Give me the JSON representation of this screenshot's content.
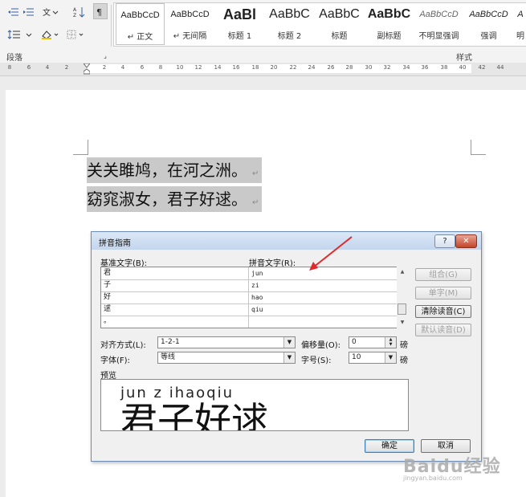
{
  "ribbon": {
    "paragraph_group_label": "段落",
    "styles_group_label": "样式",
    "styles": [
      {
        "preview": "AaBbCcD",
        "name": "↵ 正文",
        "selected": true
      },
      {
        "preview": "AaBbCcD",
        "name": "↵ 无间隔",
        "selected": false
      },
      {
        "preview": "AaBl",
        "name": "标题 1",
        "selected": false
      },
      {
        "preview": "AaBbC",
        "name": "标题 2",
        "selected": false
      },
      {
        "preview": "AaBbC",
        "name": "标题",
        "selected": false
      },
      {
        "preview": "AaBbC",
        "name": "副标题",
        "selected": false
      },
      {
        "preview": "AaBbCcD",
        "name": "不明显强调",
        "selected": false
      },
      {
        "preview": "AaBbCcD",
        "name": "强调",
        "selected": false
      },
      {
        "preview": "A",
        "name": "明",
        "selected": false
      }
    ],
    "icons": [
      "decrease-indent-icon",
      "increase-indent-icon",
      "asian-layout-icon",
      "sort-icon",
      "show-marks-icon",
      "line-spacing-icon",
      "shading-icon",
      "borders-icon"
    ]
  },
  "ruler": {
    "ticks": [
      "8",
      "6",
      "4",
      "2",
      "",
      "2",
      "4",
      "6",
      "8",
      "10",
      "12",
      "14",
      "16",
      "18",
      "20",
      "22",
      "24",
      "26",
      "28",
      "30",
      "32",
      "34",
      "36",
      "38",
      "40",
      "42",
      "44"
    ]
  },
  "document": {
    "lines": [
      "关关雎鸠，在河之洲。",
      "窈窕淑女，君子好逑。"
    ],
    "paragraph_mark": "↵"
  },
  "dialog": {
    "title": "拼音指南",
    "help_label": "?",
    "close_label": "✕",
    "base_text_label": "基准文字(B):",
    "ruby_text_label": "拼音文字(R):",
    "rows": [
      {
        "base": "君",
        "ruby": "jun"
      },
      {
        "base": "子",
        "ruby": "zi"
      },
      {
        "base": "好",
        "ruby": "hao"
      },
      {
        "base": "逑",
        "ruby": "qiu"
      },
      {
        "base": "。",
        "ruby": ""
      }
    ],
    "side_buttons": [
      {
        "label": "组合(G)",
        "enabled": false
      },
      {
        "label": "单字(M)",
        "enabled": false
      },
      {
        "label": "清除读音(C)",
        "enabled": true
      },
      {
        "label": "默认读音(D)",
        "enabled": false
      }
    ],
    "alignment_label": "对齐方式(L):",
    "alignment_value": "1-2-1",
    "offset_label": "偏移量(O):",
    "offset_value": "0",
    "offset_unit": "磅",
    "font_label": "字体(F):",
    "font_value": "等线",
    "size_label": "字号(S):",
    "size_value": "10",
    "size_unit": "磅",
    "preview_label": "预览",
    "preview_pinyin": "jun z ihaoqiu",
    "preview_hanzi": "君子好逑",
    "ok_label": "确定",
    "cancel_label": "取消"
  },
  "watermark": {
    "text": "Baidu经验",
    "sub": "jingyan.baidu.com"
  },
  "colors": {
    "selection": "#c9c9c9",
    "arrow": "#e02a2a",
    "dialog_border": "#6d8cb3"
  }
}
